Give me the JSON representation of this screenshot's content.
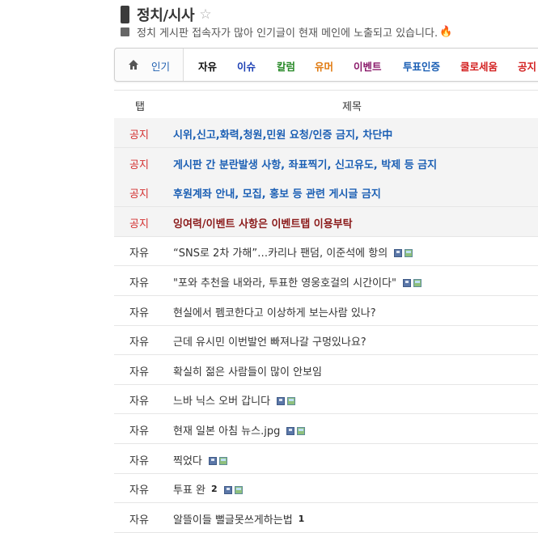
{
  "board": {
    "title": "정치/시사",
    "subtitle": "정치 게시판 접속자가 많아 인기글이 현재 메인에 노출되고 있습니다."
  },
  "nav": {
    "home_label": "인기",
    "tabs": [
      {
        "label": "자유",
        "color": "#111111"
      },
      {
        "label": "이슈",
        "color": "#1b3fb4"
      },
      {
        "label": "칼럼",
        "color": "#2a8a2a"
      },
      {
        "label": "유머",
        "color": "#e07a10"
      },
      {
        "label": "이벤트",
        "color": "#8a1a6a"
      },
      {
        "label": "투표인증",
        "color": "#1b5fb4"
      },
      {
        "label": "쿨로세움",
        "color": "#d32020"
      },
      {
        "label": "공지",
        "color": "#d32020"
      }
    ]
  },
  "table": {
    "col_tab": "탭",
    "col_title": "제목",
    "rows": [
      {
        "category": "공지",
        "title": "시위,신고,화력,청원,민원 요청/인증 금지, 차단中",
        "style": "blue",
        "notice": true
      },
      {
        "category": "공지",
        "title": "게시판 간 분란발생 사항, 좌표찍기, 신고유도, 박제 등 금지",
        "style": "blue",
        "notice": true
      },
      {
        "category": "공지",
        "title": "후원계좌 안내, 모집, 홍보 등 관련 게시글 금지",
        "style": "blue",
        "notice": true
      },
      {
        "category": "공지",
        "title": "잉여력/이벤트 사항은 이벤트탭 이용부탁",
        "style": "darkred",
        "notice": true
      },
      {
        "category": "자유",
        "title": "“SNS로 2차 가해”…카리나 팬덤, 이준석에 항의",
        "style": "plain",
        "icons": true
      },
      {
        "category": "자유",
        "title": "\"포와 추천을 내와라, 투표한 영웅호걸의 시간이다\"",
        "style": "plain",
        "icons": true
      },
      {
        "category": "자유",
        "title": "현실에서 펨코한다고 이상하게 보는사람 있나?",
        "style": "plain"
      },
      {
        "category": "자유",
        "title": "근데 유시민 이번발언 빠져나갈 구멍있나요?",
        "style": "plain"
      },
      {
        "category": "자유",
        "title": "확실히 젊은 사람들이 많이 안보임",
        "style": "plain"
      },
      {
        "category": "자유",
        "title": "느바 닉스 오버 갑니다",
        "style": "plain",
        "icons": true
      },
      {
        "category": "자유",
        "title": "현재 일본 아침 뉴스.jpg",
        "style": "plain",
        "icons": true
      },
      {
        "category": "자유",
        "title": "찍었다",
        "style": "plain",
        "icons": true
      },
      {
        "category": "자유",
        "title": "투표 완",
        "style": "plain",
        "count": "2",
        "icons": true
      },
      {
        "category": "자유",
        "title": "알뜰이들 뻘글못쓰게하는법",
        "style": "plain",
        "count": "1"
      }
    ]
  }
}
